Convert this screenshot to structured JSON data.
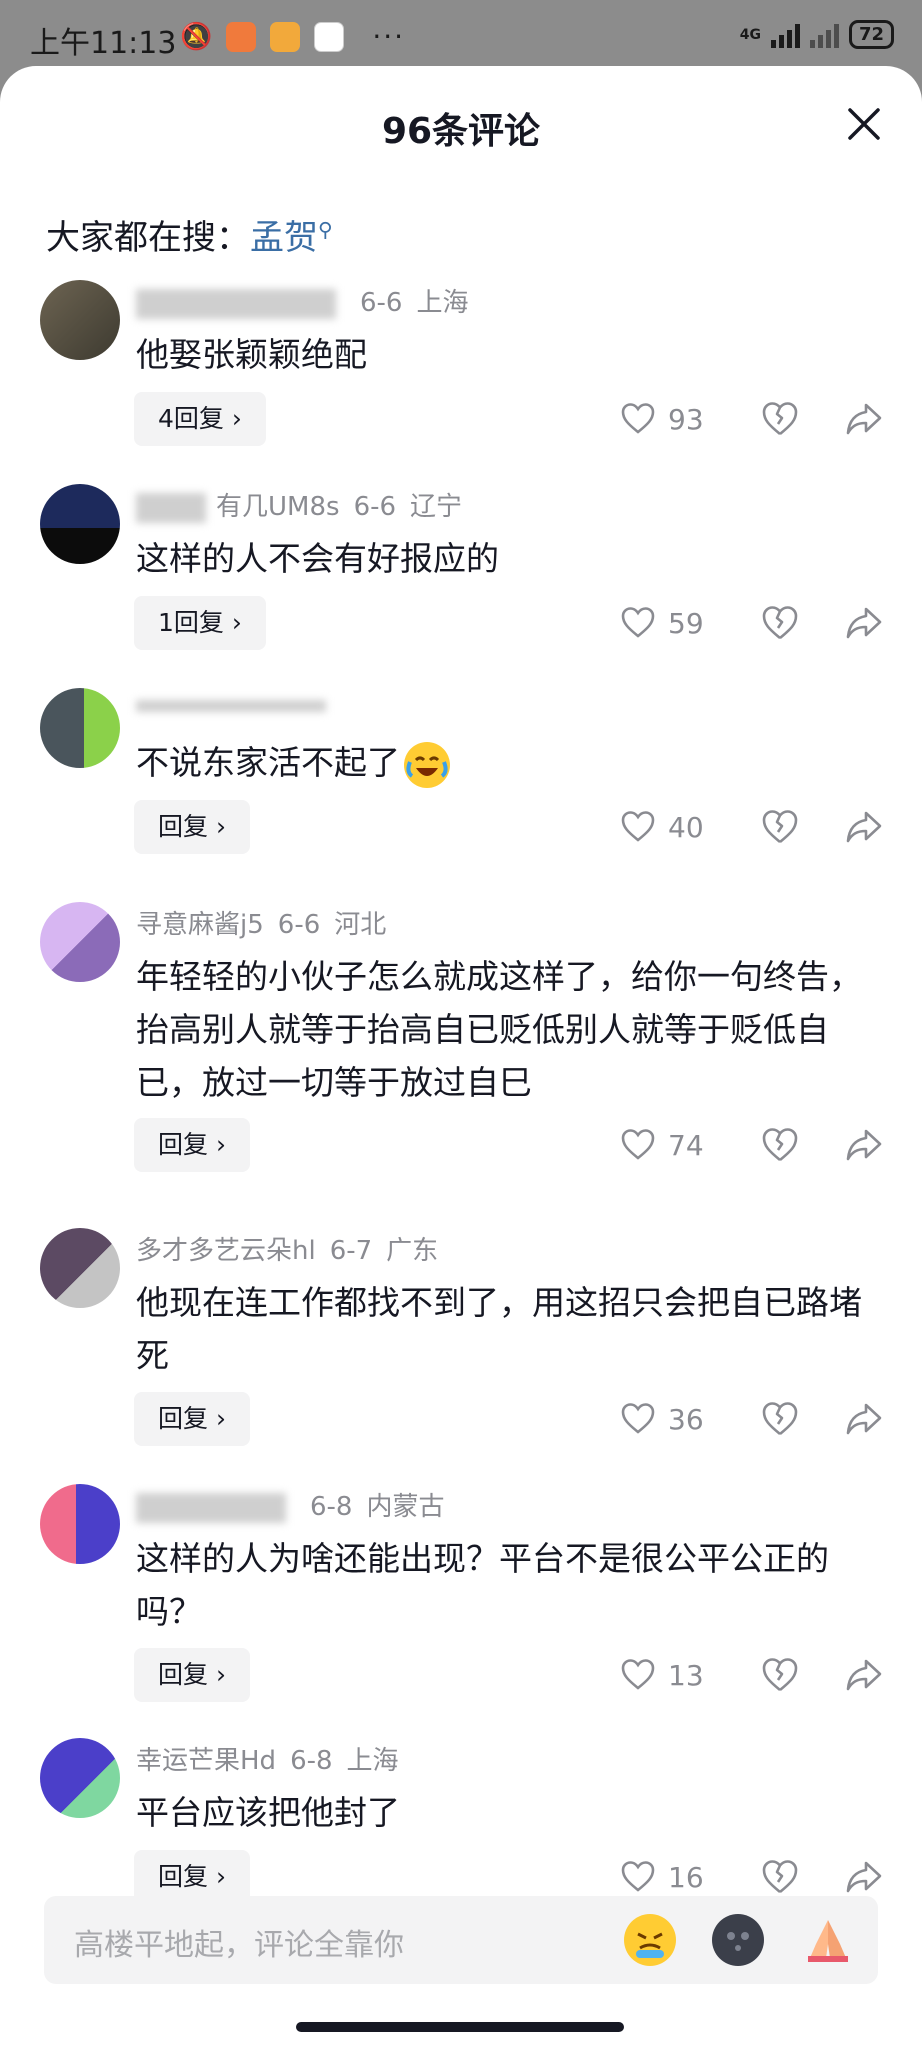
{
  "status_bar": {
    "time": "上午11:13",
    "network": "4G",
    "battery": "72"
  },
  "sheet": {
    "title": "96条评论",
    "search_prefix": "大家都在搜：",
    "search_keyword": "孟贺"
  },
  "comments": [
    {
      "user": "",
      "date": "6-6",
      "location": "上海",
      "text": "他娶张颖颖绝配",
      "reply_label": "4回复 ›",
      "likes": "93"
    },
    {
      "user": "有几UM8s",
      "date": "6-6",
      "location": "辽宁",
      "text": "这样的人不会有好报应的",
      "reply_label": "1回复 ›",
      "likes": "59"
    },
    {
      "user": "",
      "date": "",
      "location": "",
      "text": "不说东家活不起了",
      "reply_label": "回复 ›",
      "likes": "40"
    },
    {
      "user": "寻意麻酱j5",
      "date": "6-6",
      "location": "河北",
      "text": "年轻轻的小伙子怎么就成这样了，给你一句终告，抬高别人就等于抬高自已贬低别人就等于贬低自已，放过一切等于放过自巳",
      "reply_label": "回复 ›",
      "likes": "74"
    },
    {
      "user": "多才多艺云朵hl",
      "date": "6-7",
      "location": "广东",
      "text": "他现在连工作都找不到了，用这招只会把自已路堵死",
      "reply_label": "回复 ›",
      "likes": "36"
    },
    {
      "user": "",
      "date": "6-8",
      "location": "内蒙古",
      "text": "这样的人为啥还能出现？平台不是很公平公正的吗？",
      "reply_label": "回复 ›",
      "likes": "13"
    },
    {
      "user": "幸运芒果Hd",
      "date": "6-8",
      "location": "上海",
      "text": "平台应该把他封了",
      "reply_label": "回复 ›",
      "likes": "16"
    }
  ],
  "input": {
    "placeholder": "高楼平地起，评论全靠你"
  },
  "icons": {
    "close": "close-icon",
    "like": "heart-icon",
    "dislike": "broken-heart-icon",
    "share": "share-arrow-icon"
  },
  "colors": {
    "keyword": "#3a6ea5",
    "meta": "#8a8b91",
    "reply_bg": "#f3f3f4"
  }
}
